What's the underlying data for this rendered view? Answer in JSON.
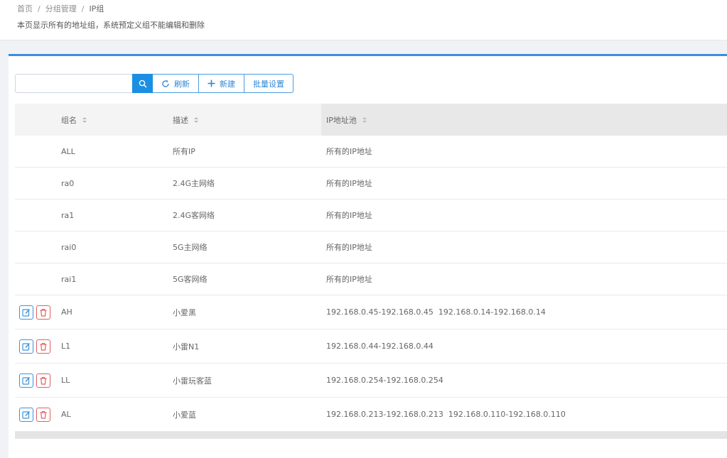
{
  "breadcrumb": {
    "items": [
      "首页",
      "分组管理"
    ],
    "current": "IP组"
  },
  "description": "本页显示所有的地址组，系统预定义组不能编辑和删除",
  "toolbar": {
    "search_value": "",
    "refresh_label": "刷新",
    "new_label": "新建",
    "batch_label": "批量设置"
  },
  "table": {
    "headers": {
      "name": "组名",
      "desc": "描述",
      "ip": "IP地址池"
    },
    "rows": [
      {
        "name": "ALL",
        "desc": "所有IP",
        "ip": "所有的IP地址",
        "editable": false
      },
      {
        "name": "ra0",
        "desc": "2.4G主网络",
        "ip": "所有的IP地址",
        "editable": false
      },
      {
        "name": "ra1",
        "desc": "2.4G客网络",
        "ip": "所有的IP地址",
        "editable": false
      },
      {
        "name": "rai0",
        "desc": "5G主网络",
        "ip": "所有的IP地址",
        "editable": false
      },
      {
        "name": "rai1",
        "desc": "5G客网络",
        "ip": "所有的IP地址",
        "editable": false
      },
      {
        "name": "AH",
        "desc": "小爱黑",
        "ip": "192.168.0.45-192.168.0.45  192.168.0.14-192.168.0.14",
        "editable": true
      },
      {
        "name": "L1",
        "desc": "小雷N1",
        "ip": "192.168.0.44-192.168.0.44",
        "editable": true
      },
      {
        "name": "LL",
        "desc": "小雷玩客蓝",
        "ip": "192.168.0.254-192.168.0.254",
        "editable": true
      },
      {
        "name": "AL",
        "desc": "小爱蓝",
        "ip": "192.168.0.213-192.168.0.213  192.168.0.110-192.168.0.110",
        "editable": true
      }
    ]
  },
  "colors": {
    "accent": "#1a8fe3",
    "edit": "#3a92dc",
    "delete": "#e06060",
    "top_border": "#3c8dde"
  },
  "icons": {
    "search": "search-icon",
    "refresh": "refresh-icon",
    "new": "plus-icon",
    "edit": "edit-icon",
    "delete": "trash-icon"
  }
}
